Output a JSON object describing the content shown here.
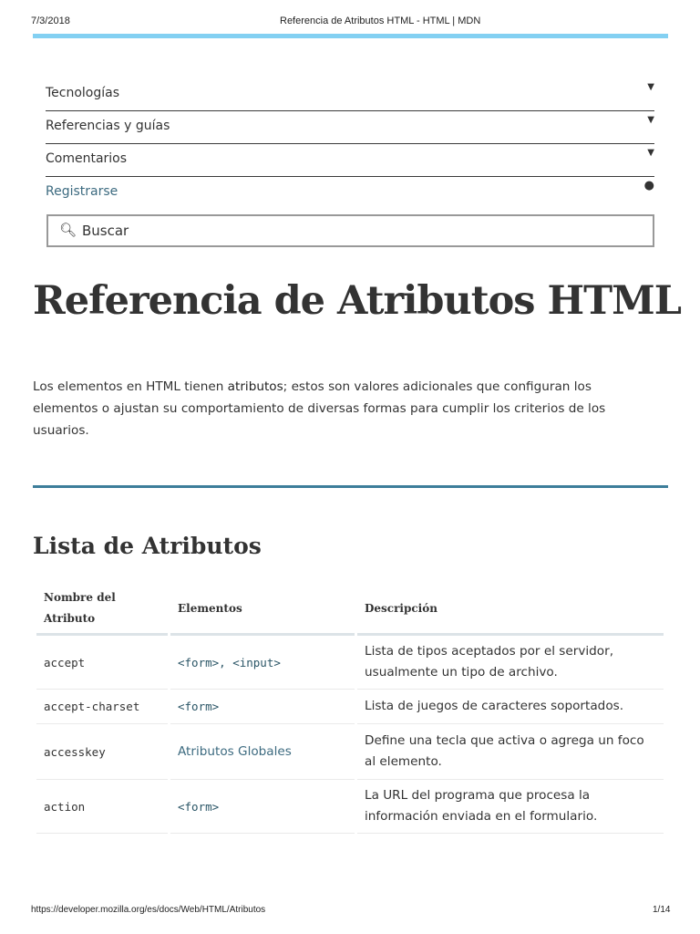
{
  "header": {
    "date": "7/3/2018",
    "title": "Referencia de Atributos HTML - HTML | MDN"
  },
  "nav": [
    {
      "label": "Tecnologías",
      "icon": "chevron-down-icon"
    },
    {
      "label": "Referencias y guías",
      "icon": "chevron-down-icon"
    },
    {
      "label": "Comentarios",
      "icon": "chevron-down-icon"
    },
    {
      "label": "Registrarse",
      "icon": "github-icon"
    }
  ],
  "search": {
    "placeholder": "Buscar"
  },
  "page_title": "Referencia de Atributos HTML",
  "intro": {
    "before": "Los elementos en HTML tienen ",
    "bold": "atributos",
    "after": "; estos son valores adicionales que configuran los elementos o ajustan su comportamiento de diversas formas para cumplir los criterios de los usuarios."
  },
  "section_title": "Lista de Atributos",
  "table": {
    "headers": [
      "Nombre del Atributo",
      "Elementos",
      "Descripción"
    ],
    "rows": [
      {
        "name": "accept",
        "elements": "<form>, <input>",
        "desc": "Lista de tipos aceptados por el servidor, usualmente un tipo de archivo."
      },
      {
        "name": "accept-charset",
        "elements": "<form>",
        "desc": "Lista de juegos de caracteres soportados."
      },
      {
        "name": "accesskey",
        "elements": "Atributos Globales",
        "desc": "Define una tecla que activa o agrega un foco al elemento."
      },
      {
        "name": "action",
        "elements": "<form>",
        "desc": "La URL del programa que procesa la información enviada en el formulario."
      }
    ]
  },
  "footer": {
    "url": "https://developer.mozilla.org/es/docs/Web/HTML/Atributos",
    "page": "1/14"
  }
}
